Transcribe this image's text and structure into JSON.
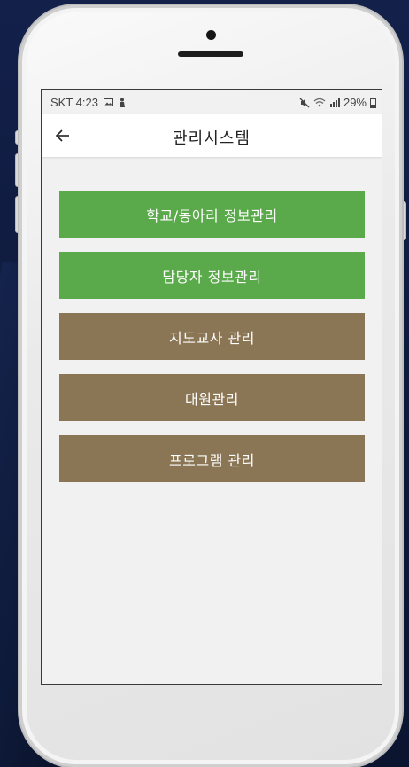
{
  "status": {
    "carrier_time": "SKT 4:23",
    "battery": "29%",
    "icons": [
      "image-icon",
      "person-icon",
      "mute-icon",
      "wifi-icon",
      "signal-icon",
      "battery-icon"
    ]
  },
  "header": {
    "back_icon": "arrow-left-icon",
    "title": "관리시스템"
  },
  "menu": {
    "items": [
      {
        "label": "학교/동아리 정보관리",
        "color": "#5aa94a"
      },
      {
        "label": "담당자 정보관리",
        "color": "#5aa94a"
      },
      {
        "label": "지도교사 관리",
        "color": "#8a7555"
      },
      {
        "label": "대원관리",
        "color": "#8a7555"
      },
      {
        "label": "프로그램 관리",
        "color": "#8a7555"
      }
    ]
  },
  "colors": {
    "green": "#5aa94a",
    "brown": "#8a7555",
    "background": "#f1f1f1"
  }
}
